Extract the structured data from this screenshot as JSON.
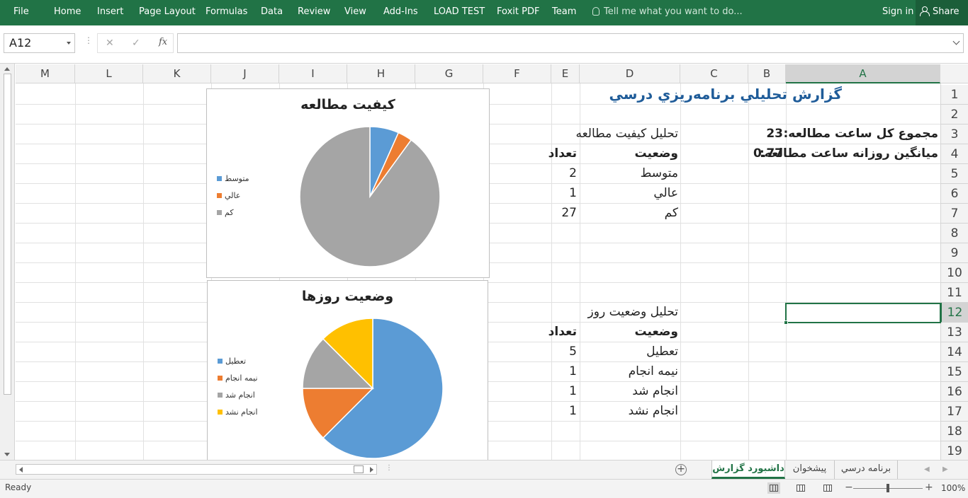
{
  "ribbon": {
    "tabs": [
      "File",
      "Home",
      "Insert",
      "Page Layout",
      "Formulas",
      "Data",
      "Review",
      "View",
      "Add-Ins",
      "LOAD TEST",
      "Foxit PDF",
      "Team"
    ],
    "tell_me": "Tell me what you want to do...",
    "sign_in": "Sign in",
    "share": "Share"
  },
  "formula_bar": {
    "name_box": "A12",
    "cancel": "✕",
    "enter": "✓",
    "fx": "fx",
    "content": ""
  },
  "columns": [
    "M",
    "L",
    "K",
    "J",
    "I",
    "H",
    "G",
    "F",
    "E",
    "D",
    "C",
    "B",
    "A"
  ],
  "rows": [
    "1",
    "2",
    "3",
    "4",
    "5",
    "6",
    "7",
    "8",
    "9",
    "10",
    "11",
    "12",
    "13",
    "14",
    "15",
    "16",
    "17",
    "18",
    "19"
  ],
  "cells": {
    "title": "گزارش تحليلي برنامه‌ريزي درسي",
    "total_hours_label": "مجموع کل ساعت مطالعه:",
    "total_hours_value": "23",
    "avg_hours_label": "ميانگين روزانه ساعت مطالعه:",
    "avg_hours_value": "0.77",
    "quality_table": {
      "title": "تحليل کيفيت مطالعه",
      "header_status": "وضعيت",
      "header_count": "تعداد",
      "rows": [
        {
          "status": "متوسط",
          "count": "2"
        },
        {
          "status": "عالي",
          "count": "1"
        },
        {
          "status": "کم",
          "count": "27"
        }
      ]
    },
    "days_table": {
      "title": "تحليل وضعيت روز",
      "header_status": "وضعيت",
      "header_count": "تعداد",
      "rows": [
        {
          "status": "تعطيل",
          "count": "5"
        },
        {
          "status": "نيمه انجام",
          "count": "1"
        },
        {
          "status": "انجام شد",
          "count": "1"
        },
        {
          "status": "انجام نشد",
          "count": "1"
        }
      ]
    }
  },
  "chart_data": [
    {
      "type": "pie",
      "title": "کيفيت مطالعه",
      "categories": [
        "متوسط",
        "عالي",
        "کم"
      ],
      "values": [
        2,
        1,
        27
      ],
      "colors": [
        "#5b9bd5",
        "#ed7d31",
        "#a5a5a5"
      ],
      "legend_position": "left"
    },
    {
      "type": "pie",
      "title": "وضعيت روزها",
      "categories": [
        "تعطيل",
        "نيمه انجام",
        "انجام شد",
        "انجام نشد"
      ],
      "values": [
        5,
        1,
        1,
        1
      ],
      "colors": [
        "#5b9bd5",
        "#ed7d31",
        "#a5a5a5",
        "#ffc000"
      ],
      "legend_position": "left"
    }
  ],
  "sheet_tabs": [
    "داشبورد گزارش",
    "پيشخوان",
    "برنامه درسي"
  ],
  "active_sheet": "داشبورد گزارش",
  "status": {
    "ready": "Ready",
    "zoom": "100%"
  },
  "colors": {
    "accent": "#217346",
    "title": "#1f5c99"
  }
}
